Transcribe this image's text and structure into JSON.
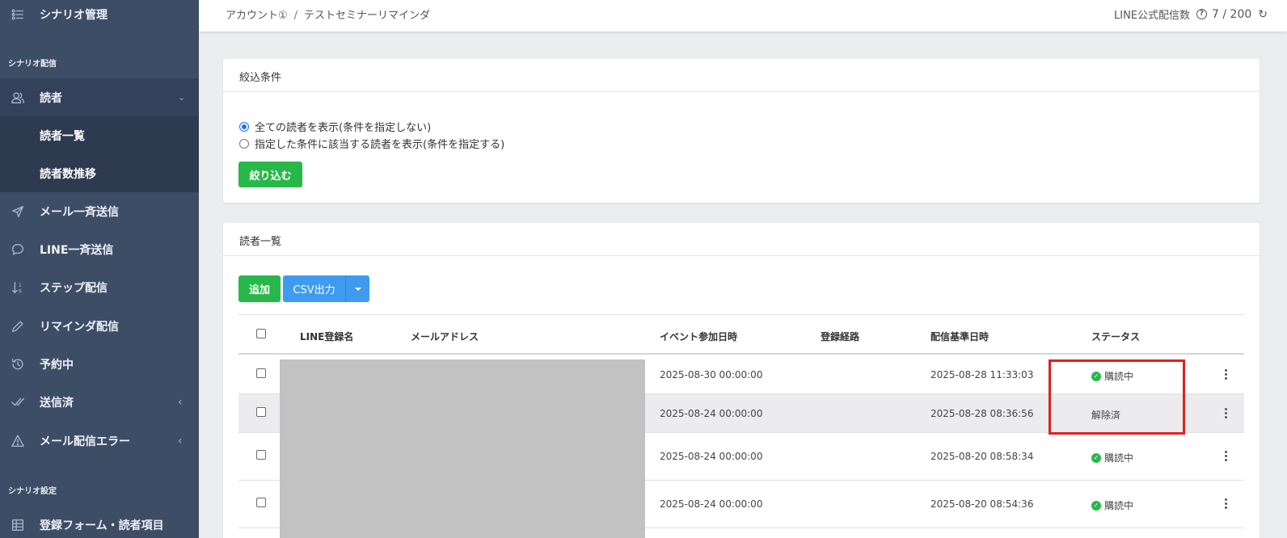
{
  "sidebar": {
    "top_item": {
      "label": "シナリオ管理",
      "icon": "list-icon"
    },
    "section1": "シナリオ配信",
    "items": [
      {
        "label": "読者",
        "icon": "users-icon",
        "chevron": "⌄"
      },
      {
        "label": "読者一覧"
      },
      {
        "label": "読者数推移"
      },
      {
        "label": "メール一斉送信",
        "icon": "send-icon"
      },
      {
        "label": "LINE一斉送信",
        "icon": "chat-icon"
      },
      {
        "label": "ステップ配信",
        "icon": "step-sort-icon"
      },
      {
        "label": "リマインダ配信",
        "icon": "pencil-icon"
      },
      {
        "label": "予約中",
        "icon": "history-icon"
      },
      {
        "label": "送信済",
        "icon": "check-double-icon",
        "chevron": "‹"
      },
      {
        "label": "メール配信エラー",
        "icon": "warning-icon",
        "chevron": "‹"
      }
    ],
    "section2": "シナリオ設定",
    "bottom_item": {
      "label": "登録フォーム・読者項目",
      "icon": "table-icon"
    }
  },
  "topbar": {
    "breadcrumb": [
      "アカウント①",
      "テストセミナーリマインダ"
    ],
    "breadcrumb_sep": "/",
    "delivery_label": "LINE公式配信数",
    "help_icon": "?",
    "delivery_count": "7 / 200"
  },
  "filter": {
    "title": "絞込条件",
    "options": [
      "全ての読者を表示(条件を指定しない)",
      "指定した条件に該当する読者を表示(条件を指定する)"
    ],
    "selected_index": 0,
    "button": "絞り込む"
  },
  "reader_list": {
    "title": "読者一覧",
    "add_button": "追加",
    "csv_button": "CSV出力",
    "columns": [
      "LINE登録名",
      "メールアドレス",
      "イベント参加日時",
      "登録経路",
      "配信基準日時",
      "ステータス"
    ],
    "rows": [
      {
        "event_date": "2025-08-30 00:00:00",
        "base_date": "2025-08-28 11:33:03",
        "status": "購読中",
        "active": true
      },
      {
        "event_date": "2025-08-24 00:00:00",
        "base_date": "2025-08-28 08:36:56",
        "status": "解除済",
        "active": false
      },
      {
        "event_date": "2025-08-24 00:00:00",
        "base_date": "2025-08-20 08:58:34",
        "status": "購読中",
        "active": true
      },
      {
        "event_date": "2025-08-24 00:00:00",
        "base_date": "2025-08-20 08:54:36",
        "status": "購読中",
        "active": true
      }
    ]
  },
  "colors": {
    "sidebar_bg": "#3d4d66",
    "accent_green": "#28b84a",
    "accent_blue": "#3e9bf0",
    "highlight_red": "#e02020"
  }
}
